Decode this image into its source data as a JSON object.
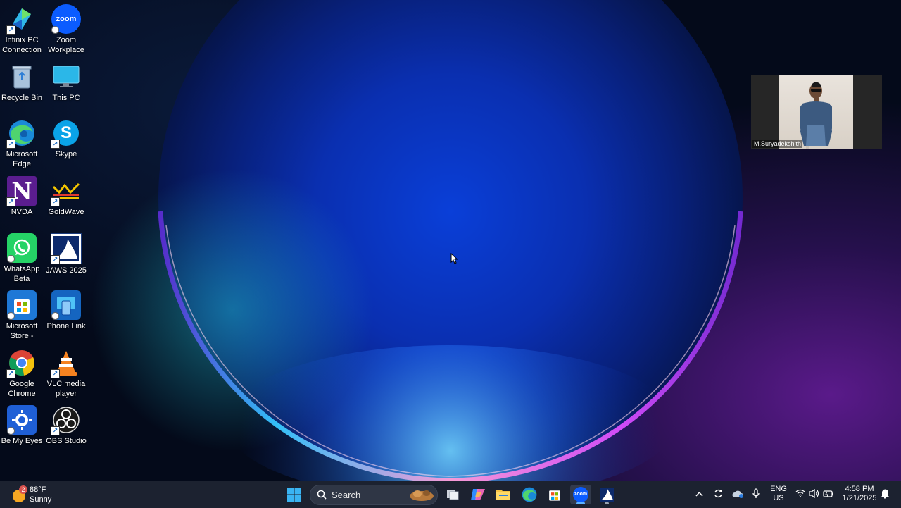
{
  "desktop": {
    "icons": [
      {
        "label": "Infinix PC Connection",
        "icon": "infinix-icon"
      },
      {
        "label": "Zoom Workplace",
        "icon": "zoom-icon"
      },
      {
        "label": "Recycle Bin",
        "icon": "recycle-bin-icon"
      },
      {
        "label": "This PC",
        "icon": "monitor-icon"
      },
      {
        "label": "Microsoft Edge",
        "icon": "edge-icon"
      },
      {
        "label": "Skype",
        "icon": "skype-icon"
      },
      {
        "label": "NVDA",
        "icon": "nvda-icon"
      },
      {
        "label": "GoldWave",
        "icon": "goldwave-icon"
      },
      {
        "label": "WhatsApp Beta",
        "icon": "whatsapp-icon"
      },
      {
        "label": "JAWS 2025",
        "icon": "jaws-icon"
      },
      {
        "label": "Microsoft Store -",
        "icon": "store-icon"
      },
      {
        "label": "Phone Link",
        "icon": "phone-link-icon"
      },
      {
        "label": "Google Chrome",
        "icon": "chrome-icon"
      },
      {
        "label": "VLC media player",
        "icon": "vlc-icon"
      },
      {
        "label": "Be My Eyes",
        "icon": "be-my-eyes-icon"
      },
      {
        "label": "OBS Studio",
        "icon": "obs-icon"
      }
    ],
    "zoom_logo_text": "zoom",
    "nvda_logo_text": "N",
    "skype_logo_text": "S"
  },
  "video_tile": {
    "participant_name": "M.Suryadekshith"
  },
  "taskbar": {
    "weather": {
      "badge": "2",
      "temperature": "88°F",
      "condition": "Sunny"
    },
    "search_placeholder": "Search",
    "pinned": [
      "start-icon",
      "search-icon",
      "task-view-icon",
      "copilot-icon",
      "file-explorer-icon",
      "edge-icon",
      "store-icon",
      "zoom-icon",
      "jaws-icon"
    ],
    "tray": {
      "language": "ENG",
      "region": "US",
      "time": "4:58 PM",
      "date": "1/21/2025"
    }
  },
  "colors": {
    "taskbar_bg": "#1c2230",
    "zoom_blue": "#0b5cff",
    "whatsapp_green": "#25d366",
    "nvda_purple": "#5b1d8f"
  }
}
